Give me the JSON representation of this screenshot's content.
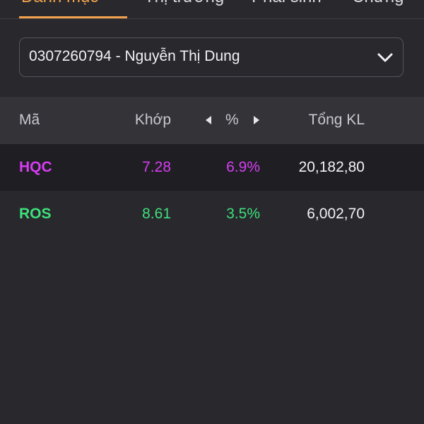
{
  "tabs": [
    {
      "label": "Danh mục",
      "active": true
    },
    {
      "label": "Thị trường",
      "active": false
    },
    {
      "label": "Phái sinh",
      "active": false
    },
    {
      "label": "Chứng",
      "active": false
    }
  ],
  "account": {
    "selected": "0307260794 - Nguyễn Thị Dung",
    "icon": "chevron-down-icon"
  },
  "table": {
    "headers": {
      "symbol": "Mã",
      "match": "Khớp",
      "percent": "%",
      "volume": "Tổng KL"
    },
    "rows": [
      {
        "symbol": "HQC",
        "match": "7.28",
        "percent": "6.9%",
        "volume": "20,182,80",
        "color": "#d63df2"
      },
      {
        "symbol": "ROS",
        "match": "8.61",
        "percent": "3.5%",
        "volume": "6,002,70",
        "color": "#3fe07a"
      }
    ]
  },
  "colors": {
    "background": "#28282d",
    "accent": "#f2a24c",
    "ceiling": "#d63df2",
    "up": "#3fe07a"
  }
}
